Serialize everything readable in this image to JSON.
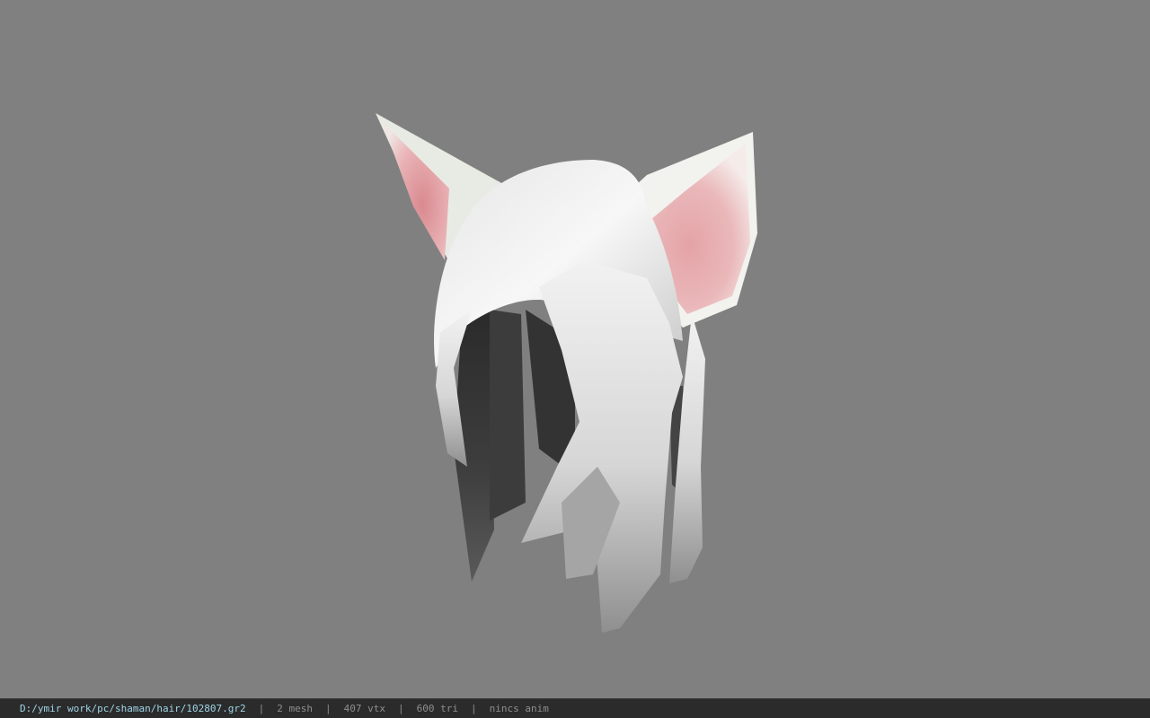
{
  "status_bar": {
    "file_path": "D:/ymir work/pc/shaman/hair/102807.gr2",
    "separator": "|",
    "mesh_count": "2 mesh",
    "vertex_count": "407 vtx",
    "triangle_count": "600 tri",
    "anim_status": "nincs anim"
  },
  "viewport": {
    "background_color": "#808080",
    "model": "white-hair-with-cat-ears"
  },
  "colors": {
    "status_path": "#9fd3e6",
    "status_text": "#8e8e8e",
    "hair": "#d8d8d8",
    "inner_ear": "#e4a8ab"
  }
}
